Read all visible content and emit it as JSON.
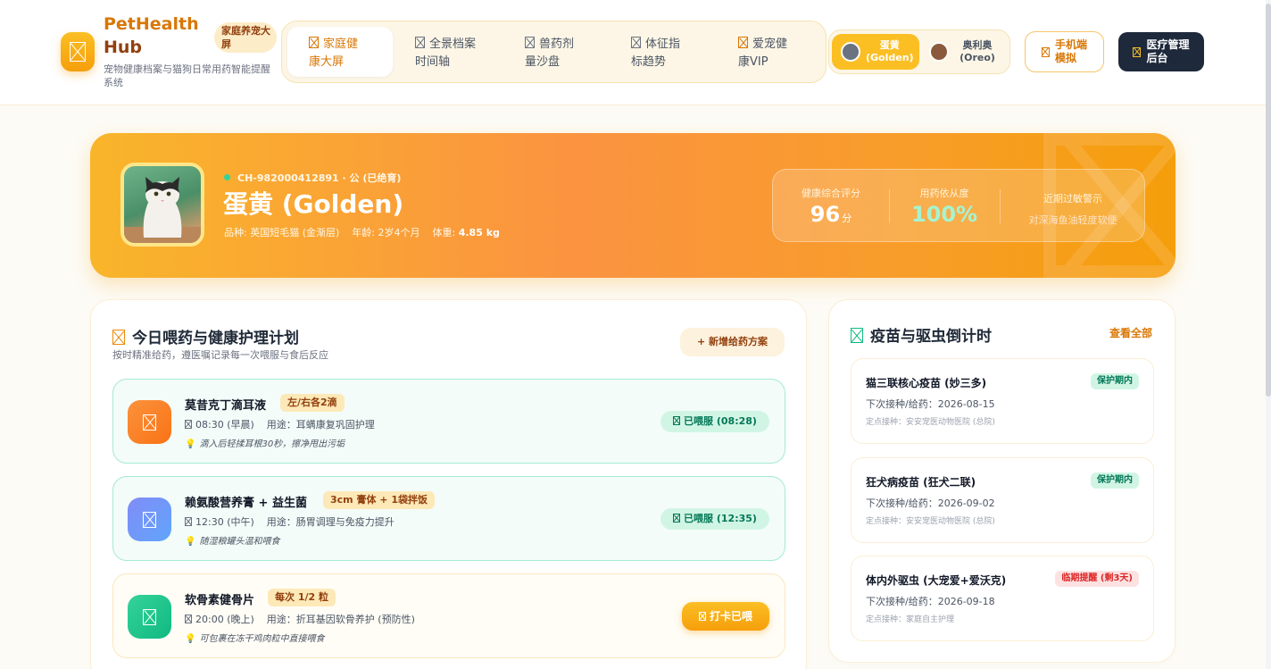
{
  "header": {
    "brand_line1": "PetHealth",
    "brand_line2": "Hub",
    "brand_badge": "家庭养宠大屏",
    "brand_subtitle": "宠物健康档案与猫狗日常用药智能提醒系统",
    "nav": [
      {
        "label_l1": "家庭健",
        "label_l2": "康大屏",
        "icon": "dashboard-icon"
      },
      {
        "label_l1": "全景档案",
        "label_l2": "时间轴",
        "icon": "timeline-icon"
      },
      {
        "label_l1": "兽药剂",
        "label_l2": "量沙盘",
        "icon": "medicine-icon"
      },
      {
        "label_l1": "体征指",
        "label_l2": "标趋势",
        "icon": "trend-icon"
      },
      {
        "label_l1": "爱宠健",
        "label_l2": "康VIP",
        "icon": "vip-icon"
      }
    ],
    "pets": [
      {
        "name_l1": "蛋黄",
        "name_l2": "(Golden)"
      },
      {
        "name_l1": "奥利奥",
        "name_l2": "(Oreo)"
      }
    ],
    "mobile_btn_l1": "手机端",
    "mobile_btn_l2": "模拟",
    "admin_btn_l1": "医疗管理",
    "admin_btn_l2": "后台"
  },
  "hero": {
    "chip_id": "CH-982000412891",
    "chip_suffix": "· 公 (已绝育)",
    "pet_name": "蛋黄 (Golden)",
    "breed_label": "品种: 英国短毛猫 (金渐层)",
    "age_label": "年龄: 2岁4个月",
    "weight_label": "体重:",
    "weight_value": "4.85 kg",
    "score_label": "健康综合评分",
    "score_value": "96",
    "score_unit": "分",
    "adherence_label": "用药依从度",
    "adherence_value": "100%",
    "allergy_label": "近期过敏警示",
    "allergy_value": "对深海鱼油轻度软便"
  },
  "plan": {
    "title": "今日喂药与健康护理计划",
    "subtitle": "按时精准给药，遵医嘱记录每一次喂服与食后反应",
    "add_btn": "+ 新增给药方案",
    "items": [
      {
        "name": "莫昔克丁滴耳液",
        "dose": "左/右各2滴",
        "time": "08:30 (早晨)",
        "purpose": "用途：耳螨康复巩固护理",
        "note": "滴入后轻揉耳根30秒，擦净甩出污垢",
        "status": "已喂服 (08:28)"
      },
      {
        "name": "赖氨酸营养膏 + 益生菌",
        "dose": "3cm 膏体 + 1袋拌饭",
        "time": "12:30 (中午)",
        "purpose": "用途：肠胃调理与免疫力提升",
        "note": "随湿粮罐头温和喂食",
        "status": "已喂服 (12:35)"
      },
      {
        "name": "软骨素健骨片",
        "dose": "每次 1/2 粒",
        "time": "20:00 (晚上)",
        "purpose": "用途：折耳基因软骨养护 (预防性)",
        "note": "可包裹在冻干鸡肉粒中直接喂食",
        "status": "打卡已喂"
      }
    ]
  },
  "vaccines": {
    "title": "疫苗与驱虫倒计时",
    "view_all": "查看全部",
    "items": [
      {
        "name": "猫三联核心疫苗 (妙三多)",
        "badge": "保护期内",
        "next": "下次接种/给药：2026-08-15",
        "loc": "定点接种：安安宠医动物医院 (总院)"
      },
      {
        "name": "狂犬病疫苗 (狂犬二联)",
        "badge": "保护期内",
        "next": "下次接种/给药：2026-09-02",
        "loc": "定点接种：安安宠医动物医院 (总院)"
      },
      {
        "name": "体内外驱虫 (大宠爱+爱沃克)",
        "badge": "临期提醒 (剩3天)",
        "next": "下次接种/给药：2026-09-18",
        "loc": "定点接种：家庭自主护理"
      }
    ]
  },
  "colors": {
    "accent": "#f59e0b",
    "brand": "#d97706",
    "success": "#047857",
    "danger": "#dc2626",
    "dark": "#1e293b"
  }
}
